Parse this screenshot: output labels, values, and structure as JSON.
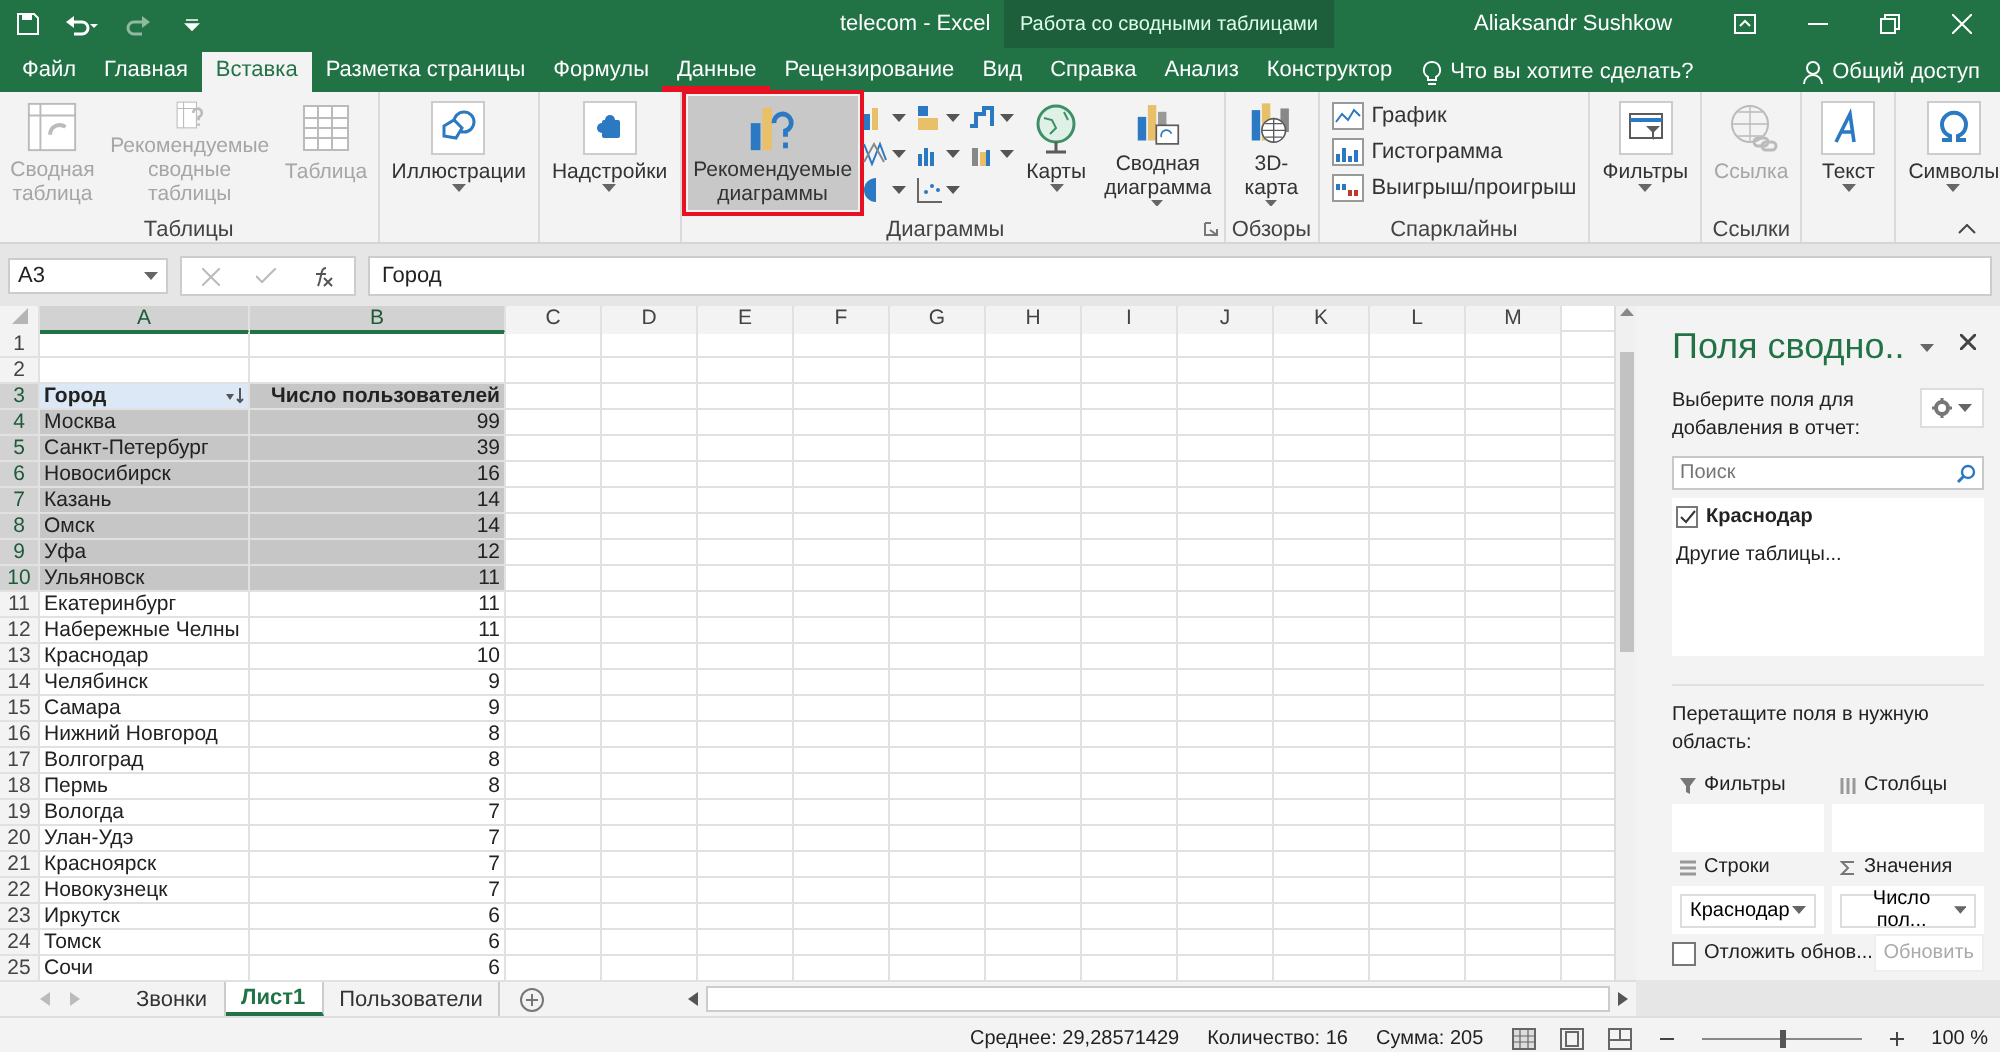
{
  "window": {
    "title": "telecom  -  Excel",
    "context_group": "Работа со сводными таблицами",
    "user": "Aliaksandr Sushkow"
  },
  "ribbon_tabs": [
    {
      "label": "Файл",
      "selected": false,
      "marked": false
    },
    {
      "label": "Главная",
      "selected": false,
      "marked": false
    },
    {
      "label": "Вставка",
      "selected": true,
      "marked": false
    },
    {
      "label": "Разметка страницы",
      "selected": false,
      "marked": false
    },
    {
      "label": "Формулы",
      "selected": false,
      "marked": false
    },
    {
      "label": "Данные",
      "selected": false,
      "marked": true
    },
    {
      "label": "Рецензирование",
      "selected": false,
      "marked": false
    },
    {
      "label": "Вид",
      "selected": false,
      "marked": false
    },
    {
      "label": "Справка",
      "selected": false,
      "marked": false
    },
    {
      "label": "Анализ",
      "selected": false,
      "marked": false
    },
    {
      "label": "Конструктор",
      "selected": false,
      "marked": false
    }
  ],
  "tell_me": "Что вы хотите сделать?",
  "share": "Общий доступ",
  "ribbon_groups": [
    {
      "label": "Таблицы",
      "buttons": [
        {
          "kind": "large",
          "label": "Сводная\nтаблица",
          "disabled": true,
          "dropdown": false,
          "highlighted": false
        },
        {
          "kind": "large",
          "label": "Рекомендуемые\nсводные таблицы",
          "disabled": true,
          "dropdown": false,
          "highlighted": false
        },
        {
          "kind": "large",
          "label": "Таблица",
          "disabled": true,
          "dropdown": false,
          "highlighted": false
        }
      ]
    },
    {
      "buttons": [
        {
          "kind": "large",
          "label": "Иллюстрации",
          "disabled": false,
          "dropdown": true,
          "highlighted": false
        }
      ]
    },
    {
      "buttons": [
        {
          "kind": "large",
          "label": "Надстройки",
          "disabled": false,
          "dropdown": true,
          "highlighted": false
        }
      ]
    },
    {
      "label": "Диаграммы",
      "launcher": true,
      "buttons": [
        {
          "kind": "large",
          "label": "Рекомендуемые\nдиаграммы",
          "disabled": false,
          "dropdown": false,
          "highlighted": true
        },
        {
          "kind": "gallery"
        },
        {
          "kind": "large",
          "label": "Карты",
          "disabled": false,
          "dropdown": true,
          "highlighted": false
        },
        {
          "kind": "large",
          "label": "Сводная\nдиаграмма",
          "disabled": false,
          "dropdown": true,
          "highlighted": false
        }
      ]
    },
    {
      "label": "Обзоры",
      "buttons": [
        {
          "kind": "large",
          "label": "3D-\nкарта",
          "disabled": false,
          "dropdown": true,
          "highlighted": false
        }
      ]
    },
    {
      "label": "Спарклайны",
      "buttons": [
        {
          "kind": "small",
          "label": "График",
          "disabled": false
        },
        {
          "kind": "small",
          "label": "Гистограмма",
          "disabled": false
        },
        {
          "kind": "small",
          "label": "Выигрыш/проигрыш",
          "disabled": false
        }
      ]
    },
    {
      "buttons": [
        {
          "kind": "large",
          "label": "Фильтры",
          "disabled": false,
          "dropdown": true,
          "highlighted": false
        }
      ]
    },
    {
      "label": "Ссылки",
      "buttons": [
        {
          "kind": "large",
          "label": "Ссылка",
          "disabled": true,
          "dropdown": false,
          "highlighted": false
        }
      ]
    },
    {
      "buttons": [
        {
          "kind": "large",
          "label": "Текст",
          "disabled": false,
          "dropdown": true,
          "highlighted": false
        }
      ]
    },
    {
      "buttons": [
        {
          "kind": "large",
          "label": "Символы",
          "disabled": false,
          "dropdown": true,
          "highlighted": false
        }
      ]
    }
  ],
  "formula_bar": {
    "name_box": "A3",
    "formula": "Город"
  },
  "sheet": {
    "columns": [
      {
        "label": "A",
        "selected": true
      },
      {
        "label": "B",
        "selected": true
      },
      {
        "label": "C",
        "selected": false
      },
      {
        "label": "D",
        "selected": false
      },
      {
        "label": "E",
        "selected": false
      },
      {
        "label": "F",
        "selected": false
      },
      {
        "label": "G",
        "selected": false
      },
      {
        "label": "H",
        "selected": false
      },
      {
        "label": "I",
        "selected": false
      },
      {
        "label": "J",
        "selected": false
      },
      {
        "label": "K",
        "selected": false
      },
      {
        "label": "L",
        "selected": false
      },
      {
        "label": "M",
        "selected": false
      }
    ],
    "rows": [
      {
        "number": "1",
        "kind": "empty",
        "selected": false
      },
      {
        "number": "2",
        "kind": "empty",
        "selected": false
      },
      {
        "number": "3",
        "kind": "header",
        "city": "Город",
        "count": "Число пользователей",
        "selected": true
      },
      {
        "number": "4",
        "kind": "data",
        "city": "Москва",
        "count": "99",
        "selected": true
      },
      {
        "number": "5",
        "kind": "data",
        "city": "Санкт-Петербург",
        "count": "39",
        "selected": true
      },
      {
        "number": "6",
        "kind": "data",
        "city": "Новосибирск",
        "count": "16",
        "selected": true
      },
      {
        "number": "7",
        "kind": "data",
        "city": "Казань",
        "count": "14",
        "selected": true
      },
      {
        "number": "8",
        "kind": "data",
        "city": "Омск",
        "count": "14",
        "selected": true
      },
      {
        "number": "9",
        "kind": "data",
        "city": "Уфа",
        "count": "12",
        "selected": true
      },
      {
        "number": "10",
        "kind": "data",
        "city": "Ульяновск",
        "count": "11",
        "selected": true
      },
      {
        "number": "11",
        "kind": "data",
        "city": "Екатеринбург",
        "count": "11",
        "selected": false
      },
      {
        "number": "12",
        "kind": "data",
        "city": "Набережные Челны",
        "count": "11",
        "selected": false
      },
      {
        "number": "13",
        "kind": "data",
        "city": "Краснодар",
        "count": "10",
        "selected": false
      },
      {
        "number": "14",
        "kind": "data",
        "city": "Челябинск",
        "count": "9",
        "selected": false
      },
      {
        "number": "15",
        "kind": "data",
        "city": "Самара",
        "count": "9",
        "selected": false
      },
      {
        "number": "16",
        "kind": "data",
        "city": "Нижний Новгород",
        "count": "8",
        "selected": false
      },
      {
        "number": "17",
        "kind": "data",
        "city": "Волгоград",
        "count": "8",
        "selected": false
      },
      {
        "number": "18",
        "kind": "data",
        "city": "Пермь",
        "count": "8",
        "selected": false
      },
      {
        "number": "19",
        "kind": "data",
        "city": "Вологда",
        "count": "7",
        "selected": false
      },
      {
        "number": "20",
        "kind": "data",
        "city": "Улан-Удэ",
        "count": "7",
        "selected": false
      },
      {
        "number": "21",
        "kind": "data",
        "city": "Красноярск",
        "count": "7",
        "selected": false
      },
      {
        "number": "22",
        "kind": "data",
        "city": "Новокузнецк",
        "count": "7",
        "selected": false
      },
      {
        "number": "23",
        "kind": "data",
        "city": "Иркутск",
        "count": "6",
        "selected": false
      },
      {
        "number": "24",
        "kind": "data",
        "city": "Томск",
        "count": "6",
        "selected": false
      },
      {
        "number": "25",
        "kind": "data",
        "city": "Сочи",
        "count": "6",
        "selected": false
      }
    ]
  },
  "sheet_tabs": [
    {
      "label": "Звонки",
      "selected": false
    },
    {
      "label": "Лист1",
      "selected": true
    },
    {
      "label": "Пользователи",
      "selected": false
    }
  ],
  "pivot_pane": {
    "title": "Поля сводно..",
    "prompt": "Выберите поля для добавления в отчет:",
    "search_placeholder": "Поиск",
    "fields": [
      {
        "label": "Краснодар",
        "checked": true
      }
    ],
    "more_tables": "Другие таблицы...",
    "drag_hint": "Перетащите поля в нужную область:",
    "areas": [
      {
        "label": "Фильтры"
      },
      {
        "label": "Столбцы"
      },
      {
        "label": "Строки",
        "chip": "Краснодар"
      },
      {
        "label": "Значения",
        "chip": "Число пол..."
      }
    ],
    "defer": {
      "label": "Отложить обнов...",
      "checked": false
    },
    "update_button": {
      "label": "Обновить",
      "disabled": true
    }
  },
  "status_bar": {
    "average": "Среднее: 29,28571429",
    "count": "Количество: 16",
    "sum": "Сумма: 205",
    "zoom": "100 %",
    "zoom_slider": {
      "level": 0.5
    }
  }
}
